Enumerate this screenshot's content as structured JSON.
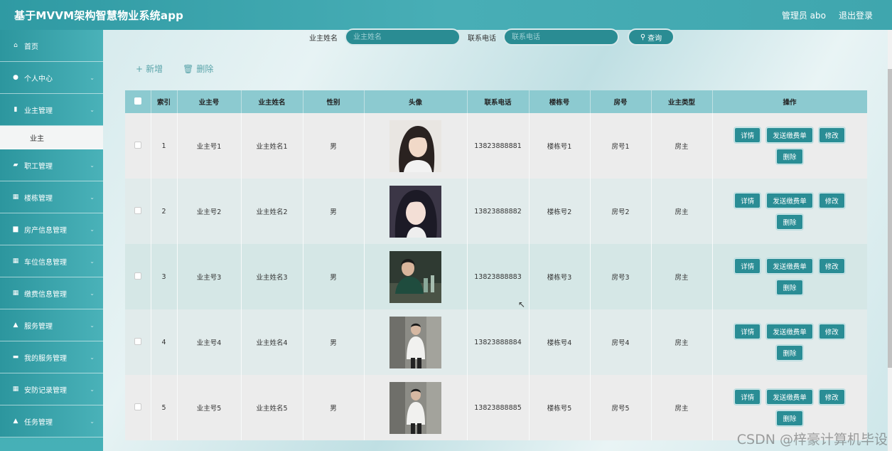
{
  "header": {
    "title": "基于MVVM架构智慧物业系统app",
    "user": "管理员 abo",
    "logout": "退出登录"
  },
  "sidebar": {
    "items": [
      {
        "label": "首页",
        "icon": "home-icon",
        "glyph": "⌂"
      },
      {
        "label": "个人中心",
        "icon": "user-icon",
        "glyph": "●"
      },
      {
        "label": "业主管理",
        "icon": "document-icon",
        "glyph": "▮"
      },
      {
        "label": "职工管理",
        "icon": "thumb-icon",
        "glyph": "▰"
      },
      {
        "label": "楼栋管理",
        "icon": "grid-icon",
        "glyph": "▦"
      },
      {
        "label": "房产信息管理",
        "icon": "flag-icon",
        "glyph": "▆"
      },
      {
        "label": "车位信息管理",
        "icon": "grid-icon",
        "glyph": "▦"
      },
      {
        "label": "缴费信息管理",
        "icon": "grid-icon",
        "glyph": "▦"
      },
      {
        "label": "服务管理",
        "icon": "person-icon",
        "glyph": "▲"
      },
      {
        "label": "我的服务管理",
        "icon": "stack-icon",
        "glyph": "▬"
      },
      {
        "label": "安防记录管理",
        "icon": "grid-icon",
        "glyph": "▦"
      },
      {
        "label": "任务管理",
        "icon": "person-icon",
        "glyph": "▲"
      }
    ],
    "submenu": {
      "label": "业主"
    }
  },
  "search": {
    "name_label": "业主姓名",
    "name_placeholder": "业主姓名",
    "phone_label": "联系电话",
    "phone_placeholder": "联系电话",
    "button": "查询"
  },
  "toolbar": {
    "add": "新增",
    "delete": "删除"
  },
  "table": {
    "columns": [
      "索引",
      "业主号",
      "业主姓名",
      "性别",
      "头像",
      "联系电话",
      "楼栋号",
      "房号",
      "业主类型",
      "操作"
    ],
    "rows": [
      {
        "index": "1",
        "owner_no": "业主号1",
        "name": "业主姓名1",
        "gender": "男",
        "phone": "13823888881",
        "building": "楼栋号1",
        "room": "房号1",
        "type": "房主"
      },
      {
        "index": "2",
        "owner_no": "业主号2",
        "name": "业主姓名2",
        "gender": "男",
        "phone": "13823888882",
        "building": "楼栋号2",
        "room": "房号2",
        "type": "房主"
      },
      {
        "index": "3",
        "owner_no": "业主号3",
        "name": "业主姓名3",
        "gender": "男",
        "phone": "13823888883",
        "building": "楼栋号3",
        "room": "房号3",
        "type": "房主"
      },
      {
        "index": "4",
        "owner_no": "业主号4",
        "name": "业主姓名4",
        "gender": "男",
        "phone": "13823888884",
        "building": "楼栋号4",
        "room": "房号4",
        "type": "房主"
      },
      {
        "index": "5",
        "owner_no": "业主号5",
        "name": "业主姓名5",
        "gender": "男",
        "phone": "13823888885",
        "building": "楼栋号5",
        "room": "房号5",
        "type": "房主"
      }
    ],
    "actions": {
      "detail": "详情",
      "send_bill": "发送缴费单",
      "edit": "修改",
      "delete": "删除"
    }
  },
  "watermark": "CSDN @梓豪计算机毕设",
  "colors": {
    "accent": "#2a8d95",
    "header": "#3fa6ae",
    "table_head": "#8ccad0"
  }
}
